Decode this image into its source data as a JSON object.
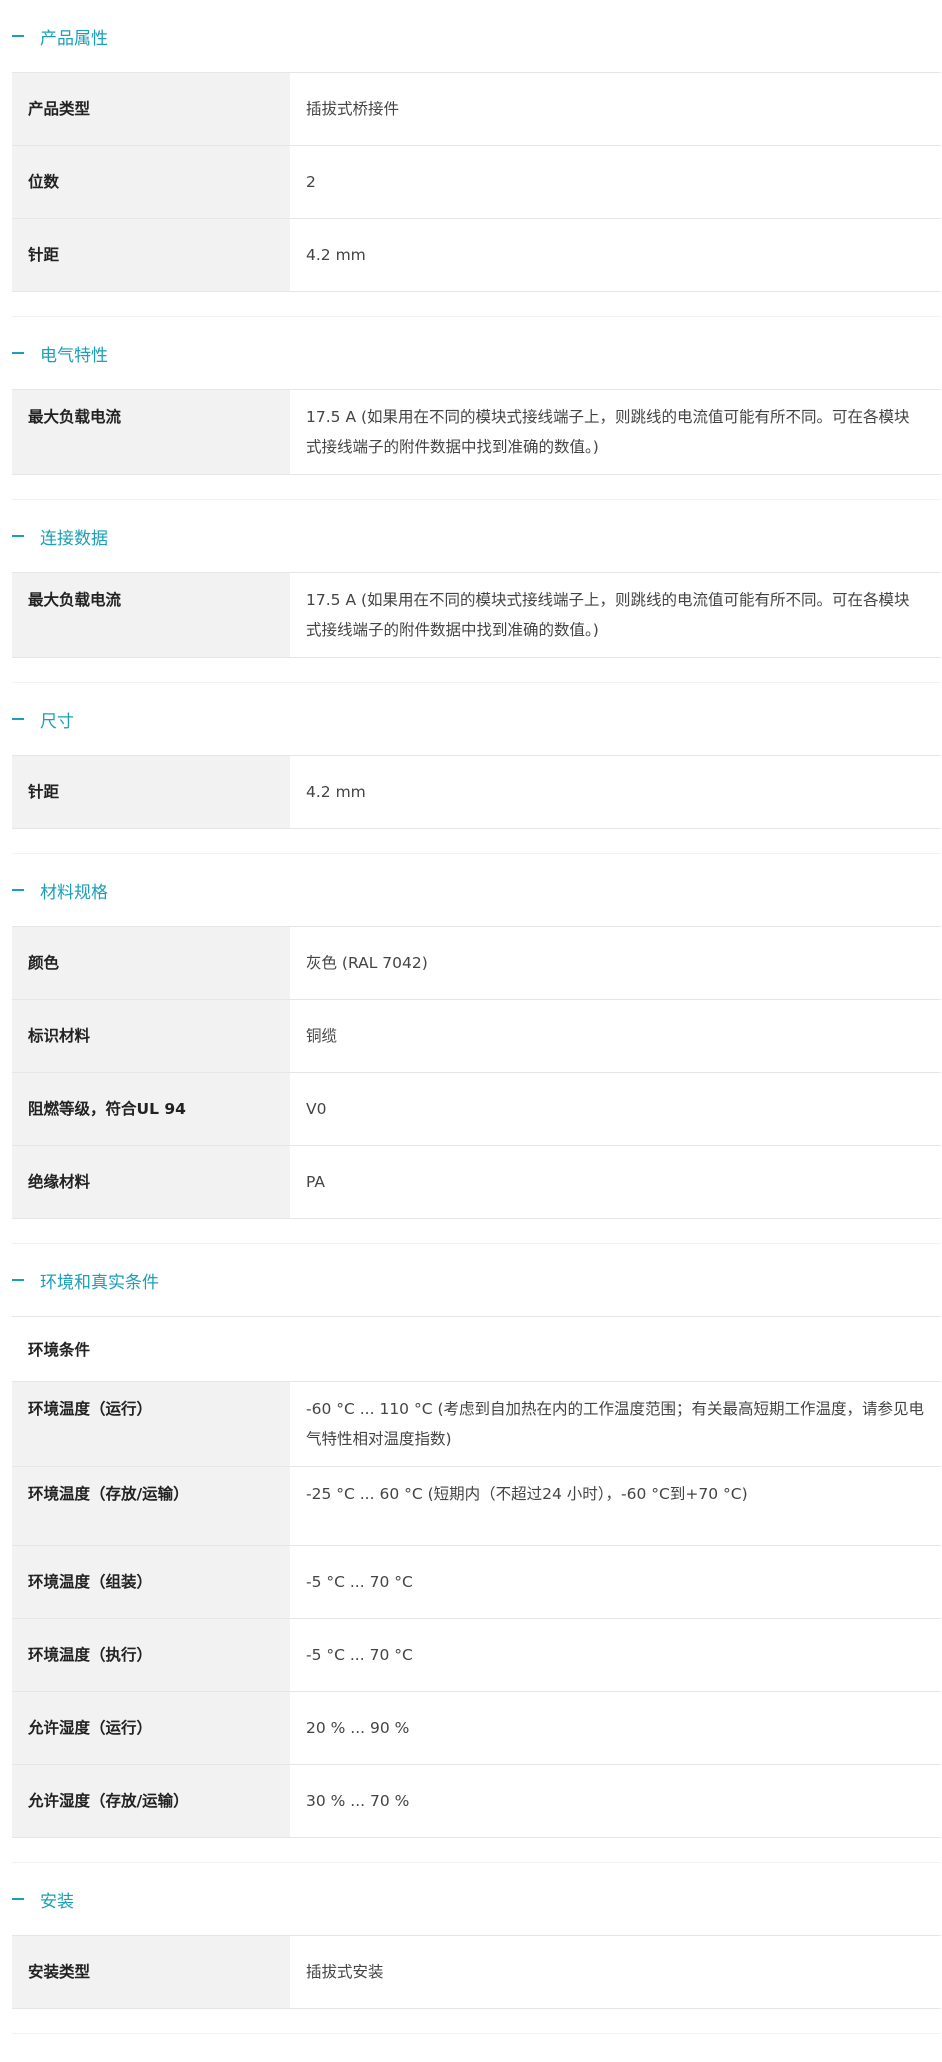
{
  "sections": [
    {
      "title": "产品属性",
      "rows": [
        {
          "label": "产品类型",
          "value": "插拔式桥接件"
        },
        {
          "label": "位数",
          "value": "2"
        },
        {
          "label": "针距",
          "value": "4.2 mm"
        }
      ]
    },
    {
      "title": "电气特性",
      "rows": [
        {
          "label": "最大负载电流",
          "value": "17.5 A (如果用在不同的模块式接线端子上，则跳线的电流值可能有所不同。可在各模块式接线端子的附件数据中找到准确的数值。)"
        }
      ]
    },
    {
      "title": "连接数据",
      "rows": [
        {
          "label": "最大负载电流",
          "value": "17.5 A (如果用在不同的模块式接线端子上，则跳线的电流值可能有所不同。可在各模块式接线端子的附件数据中找到准确的数值。)"
        }
      ]
    },
    {
      "title": "尺寸",
      "rows": [
        {
          "label": "针距",
          "value": "4.2 mm"
        }
      ]
    },
    {
      "title": "材料规格",
      "rows": [
        {
          "label": "颜色",
          "value": "灰色 (RAL 7042)"
        },
        {
          "label": "标识材料",
          "value": "铜缆"
        },
        {
          "label": "阻燃等级，符合UL 94",
          "value": "V0"
        },
        {
          "label": "绝缘材料",
          "value": "PA"
        }
      ]
    },
    {
      "title": "环境和真实条件",
      "subheading": "环境条件",
      "rows": [
        {
          "label": "环境温度（运行）",
          "value": "-60 °C ... 110 °C (考虑到自加热在内的工作温度范围；有关最高短期工作温度，请参见电气特性相对温度指数)"
        },
        {
          "label": "环境温度（存放/运输）",
          "value": "-25 °C ... 60 °C (短期内（不超过24  小时），-60 °C到+70 °C)"
        },
        {
          "label": "环境温度（组装）",
          "value": "-5 °C ... 70 °C"
        },
        {
          "label": "环境温度（执行）",
          "value": "-5 °C ... 70 °C"
        },
        {
          "label": "允许湿度（运行）",
          "value": "20 % ... 90 %"
        },
        {
          "label": "允许湿度（存放/运输）",
          "value": "30 % ... 70 %"
        }
      ]
    },
    {
      "title": "安装",
      "rows": [
        {
          "label": "安装类型",
          "value": "插拔式安装"
        }
      ]
    }
  ],
  "colors": {
    "accent": "#1aa0b8",
    "label_bg": "#f2f2f2",
    "border": "#e6e6e6"
  },
  "icons": {
    "section_toggle": "minus-icon"
  }
}
